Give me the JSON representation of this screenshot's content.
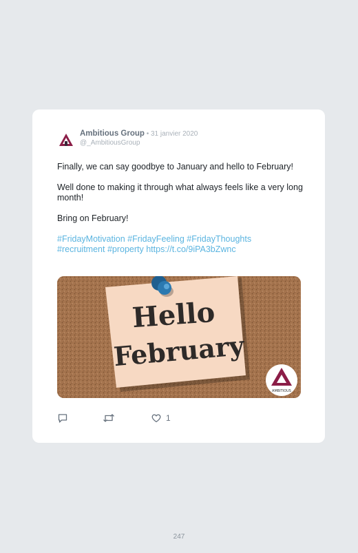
{
  "tweet": {
    "author_name": "Ambitious Group",
    "date": " • 31 janvier 2020",
    "handle": "@_AmbitiousGroup",
    "paragraphs": [
      "Finally, we can say goodbye to January and hello to February!",
      "Well done to making it through what always feels like a very long month!",
      "Bring on February!"
    ],
    "hashtags_line1": "#FridayMotivation #FridayFeeling #FridayThoughts",
    "hashtags_line2": "#recruitment #property https://t.co/9iPA3bZwnc",
    "image": {
      "note_line1": "Hello",
      "note_line2": "February",
      "logo_text": "AMBITIOUS"
    },
    "actions": {
      "like_count": "1"
    }
  },
  "page_number": "247",
  "colors": {
    "background": "#e6e9ec",
    "card": "#ffffff",
    "link": "#5ab4e0",
    "logo": "#8b1d47"
  }
}
